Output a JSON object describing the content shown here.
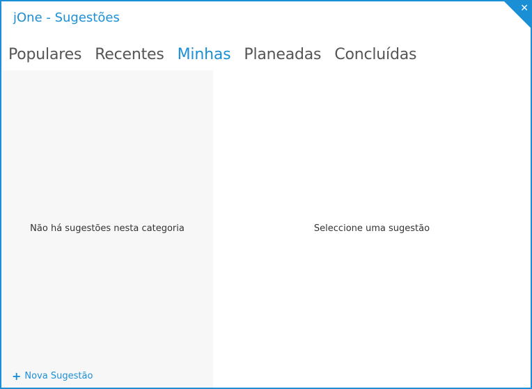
{
  "window": {
    "title": "jOne - Sugestões",
    "close_icon": "close-icon",
    "accent_color": "#1b8fd6"
  },
  "tabs": [
    {
      "label": "Populares",
      "active": false
    },
    {
      "label": "Recentes",
      "active": false
    },
    {
      "label": "Minhas",
      "active": true
    },
    {
      "label": "Planeadas",
      "active": false
    },
    {
      "label": "Concluídas",
      "active": false
    }
  ],
  "left_pane": {
    "empty_message": "Não há sugestões nesta categoria",
    "new_suggestion_label": "Nova Sugestão",
    "new_suggestion_icon": "plus-icon"
  },
  "right_pane": {
    "placeholder_message": "Seleccione uma sugestão"
  }
}
